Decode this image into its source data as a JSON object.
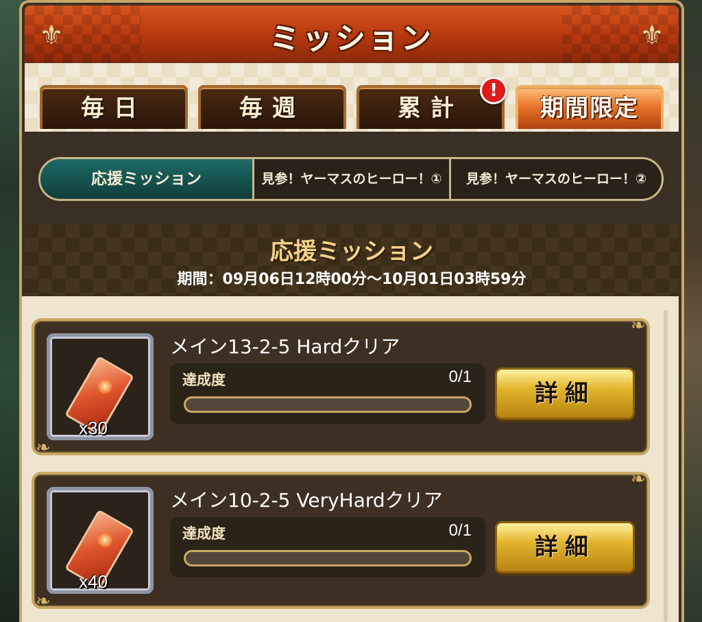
{
  "header": {
    "title": "ミッション"
  },
  "main_tabs": [
    {
      "label": "毎日",
      "active": false
    },
    {
      "label": "毎週",
      "active": false
    },
    {
      "label": "累計",
      "active": false,
      "badge": "!"
    },
    {
      "label": "期間限定",
      "active": true
    }
  ],
  "sub_tabs": [
    {
      "label": "応援ミッション",
      "active": true
    },
    {
      "label": "見参！ヤーマスのヒーロー！①",
      "active": false
    },
    {
      "label": "見参！ヤーマスのヒーロー！②",
      "active": false
    }
  ],
  "section": {
    "title": "応援ミッション",
    "period": "期間：09月06日12時00分～10月01日03時59分"
  },
  "missions": [
    {
      "name": "メイン13-2-5 Hardクリア",
      "progress_label": "達成度",
      "progress_text": "0/1",
      "progress_fraction": 0,
      "reward_qty": "x30",
      "detail_label": "詳細"
    },
    {
      "name": "メイン10-2-5 VeryHardクリア",
      "progress_label": "達成度",
      "progress_text": "0/1",
      "progress_fraction": 0,
      "reward_qty": "x40",
      "detail_label": "詳細"
    }
  ],
  "colors": {
    "header": "#c2410f",
    "active_tab": "#e7752a",
    "active_subtab": "#1f6a66",
    "button_gold": "#e2b42b",
    "badge_red": "#e11a1a"
  }
}
